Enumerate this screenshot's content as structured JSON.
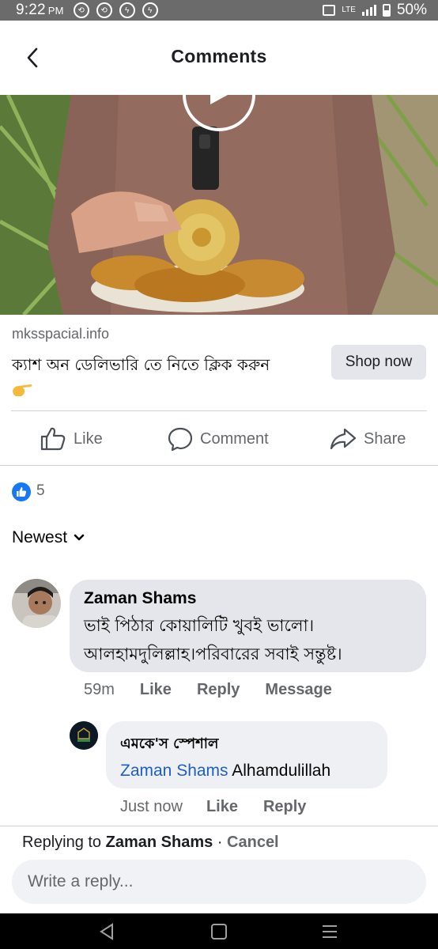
{
  "status_bar": {
    "time": "9:22",
    "ampm": "PM",
    "network": "LTE",
    "battery": "50%"
  },
  "header": {
    "title": "Comments"
  },
  "ad": {
    "domain": "mksspacial.info",
    "text": "ক্যাশ অন ডেলিভারি তে নিতে ক্লিক করুন",
    "button_label": "Shop now"
  },
  "actions": {
    "like": "Like",
    "comment": "Comment",
    "share": "Share"
  },
  "reactions": {
    "count": "5"
  },
  "sort": {
    "label": "Newest"
  },
  "comment": {
    "author": "Zaman Shams",
    "text": "ভাই পিঠার কোয়ালিটি খুবই ভালো। আলহামদুলিল্লাহ।পরিবারের সবাই সন্তুষ্ট।",
    "time": "59m",
    "like": "Like",
    "reply": "Reply",
    "message": "Message"
  },
  "reply": {
    "author": "এমকে'স স্পেশাল",
    "mention": "Zaman Shams",
    "text": "Alhamdulillah",
    "time": "Just now",
    "like": "Like",
    "reply": "Reply"
  },
  "composer": {
    "replying_prefix": "Replying to",
    "replying_to": "Zaman Shams",
    "separator": "·",
    "cancel": "Cancel",
    "placeholder": "Write a reply..."
  },
  "colors": {
    "facebook_blue": "#1877f2",
    "mention_blue": "#1d5fc4",
    "secondary_text": "#65676b",
    "bubble_gray": "#e4e6eb"
  }
}
